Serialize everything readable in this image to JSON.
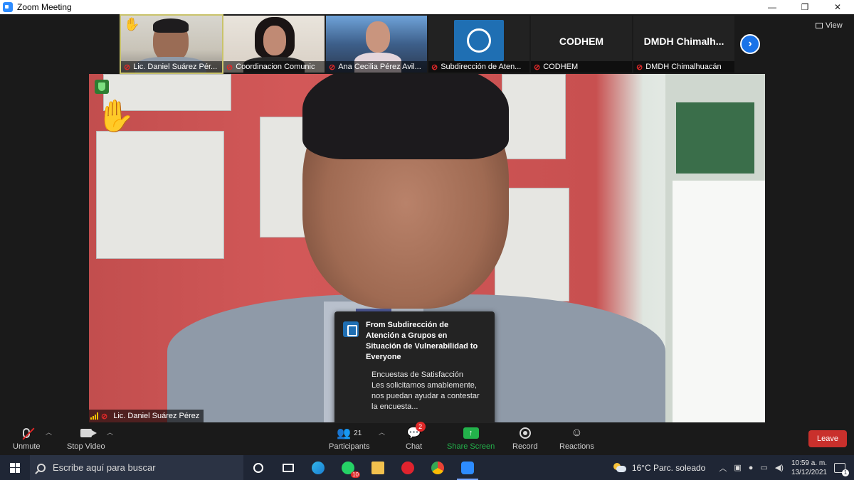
{
  "window": {
    "title": "Zoom Meeting",
    "minimize": "—",
    "restore": "❐",
    "close": "✕"
  },
  "view_button": {
    "label": "View"
  },
  "thumbnails": [
    {
      "name": "Lic. Daniel Suárez Pér...",
      "has_video": true,
      "active": true
    },
    {
      "name": "Coordinacion Comunic",
      "has_video": true
    },
    {
      "name": "Ana Cecilia Pérez Avil...",
      "has_video": true
    },
    {
      "name": "Subdirección de Aten...",
      "has_video": true
    },
    {
      "name": "CODHEM",
      "big_name": "CODHEM",
      "has_video": false
    },
    {
      "name": "DMDH Chimalhuacán",
      "big_name": "DMDH  Chimalh...",
      "has_video": false
    }
  ],
  "active_speaker": {
    "name": "Lic. Daniel Suárez Pérez"
  },
  "chat_toast": {
    "from": "From Subdirección de Atención a Grupos en Situación de Vulnerabilidad to Everyone",
    "message": "Encuestas de Satisfacción\nLes solicitamos amablemente, nos puedan ayudar a contestar la encuesta..."
  },
  "toolbar": {
    "unmute": "Unmute",
    "stop_video": "Stop Video",
    "participants": "Participants",
    "participants_count": "21",
    "chat": "Chat",
    "chat_badge": "2",
    "share_screen": "Share Screen",
    "share_arrow": "↑",
    "record": "Record",
    "reactions": "Reactions",
    "leave": "Leave"
  },
  "taskbar": {
    "search_placeholder": "Escribe aquí para buscar",
    "whatsapp_badge": "10",
    "weather": "16°C  Parc. soleado",
    "time": "10:59 a. m.",
    "date": "13/12/2021",
    "notification_count": "1"
  },
  "colors": {
    "share_green": "#23b24b",
    "leave_red": "#c9302c",
    "zoom_blue": "#2d8cff",
    "taskbar": "#1f2635"
  }
}
